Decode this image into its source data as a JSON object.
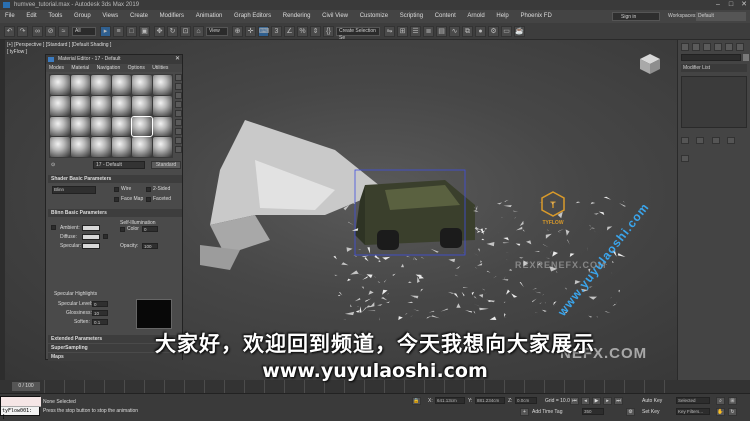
{
  "window": {
    "title": "humvee_tutorial.max - Autodesk 3ds Max 2019",
    "min": "–",
    "max": "□",
    "close": "✕"
  },
  "menubar": {
    "items": [
      "File",
      "Edit",
      "Tools",
      "Group",
      "Views",
      "Create",
      "Modifiers",
      "Animation",
      "Graph Editors",
      "Rendering",
      "Civil View",
      "Customize",
      "Scripting",
      "Content",
      "Arnold",
      "Help",
      "Phoenix FD"
    ],
    "signin": "Sign in",
    "workspaces_label": "Workspaces:",
    "workspace_value": "Default"
  },
  "toolbar": {
    "selection_filter": "All",
    "ref_coord": "View",
    "named_selection": "Create Selection Se"
  },
  "viewport": {
    "label": "[+] [Perspective ] [Standard ] [Default Shading ]",
    "sublabel": "[ tyFlow ]"
  },
  "material_editor": {
    "title": "Material Editor - 17 - Default",
    "menu": [
      "Modes",
      "Material",
      "Navigation",
      "Options",
      "Utilities"
    ],
    "material_name": "17 - Default",
    "material_type": "Standard",
    "shader_rollout": "Shader Basic Parameters",
    "shader_type": "Blinn",
    "wire": "Wire",
    "two_sided": "2-Sided",
    "face_map": "Face Map",
    "faceted": "Faceted",
    "blinn_rollout": "Blinn Basic Parameters",
    "self_illum": "Self-Illumination",
    "ambient": "Ambient:",
    "diffuse": "Diffuse:",
    "specular": "Specular:",
    "color_label": "Color",
    "color_value": "0",
    "opacity_label": "Opacity:",
    "opacity_value": "100",
    "spec_highlights": "Specular Highlights",
    "spec_level_label": "Specular Level:",
    "spec_level_value": "0",
    "glossiness_label": "Glossiness:",
    "glossiness_value": "10",
    "soften_label": "Soften:",
    "soften_value": "0.1",
    "extended_rollout": "Extended Parameters",
    "supersampling_rollout": "SuperSampling",
    "maps_rollout": "Maps"
  },
  "command_panel": {
    "modifier_list": "Modifier List"
  },
  "timeline": {
    "frame": "0 / 100"
  },
  "statusbar": {
    "maxscript": "tyFlow001: [",
    "selection": "None Selected",
    "prompt": "Press the stop button to stop the animation",
    "x_label": "X:",
    "x_value": "641.13cm",
    "y_label": "Y:",
    "y_value": "881.234cm",
    "z_label": "Z:",
    "z_value": "0.0cm",
    "grid": "Grid = 10.0cm",
    "add_time_tag": "Add Time Tag",
    "auto_key": "Auto Key",
    "selected": "Selected",
    "set_key": "Set Key",
    "key_filters": "Key Filters...",
    "frame_field": "350"
  },
  "overlay": {
    "subtitle_zh": "大家好，欢迎回到频道，今天我想向大家展示",
    "subtitle_url": "www.yuyulaoshi.com",
    "watermark_diag": "www.yuyulaoshi.com",
    "watermark_corner": "NEFX.COM",
    "watermark_mid": "REXRENEFX.COM",
    "logo_text": "TYFLOW"
  }
}
